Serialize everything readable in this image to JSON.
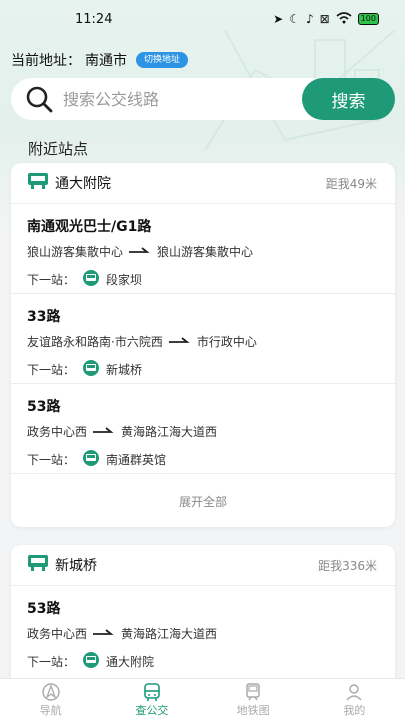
{
  "status_bar": {
    "time": "11:24",
    "battery": "100"
  },
  "address": {
    "label": "当前地址：",
    "city": "南通市",
    "switch_label": "切换地址"
  },
  "search": {
    "placeholder": "搜索公交线路",
    "button_label": "搜索"
  },
  "section_title": "附近站点",
  "stations": [
    {
      "name": "通大附院",
      "distance": "距我49米",
      "routes": [
        {
          "name": "南通观光巴士/G1路",
          "from": "狼山游客集散中心",
          "to": "狼山游客集散中心",
          "next_label": "下一站：",
          "next_stop": "段家坝"
        },
        {
          "name": "33路",
          "from": "友谊路永和路南·市六院西",
          "to": "市行政中心",
          "next_label": "下一站：",
          "next_stop": "新城桥"
        },
        {
          "name": "53路",
          "from": "政务中心西",
          "to": "黄海路江海大道西",
          "next_label": "下一站：",
          "next_stop": "南通群英馆"
        }
      ],
      "expand_label": "展开全部"
    },
    {
      "name": "新城桥",
      "distance": "距我336米",
      "routes": [
        {
          "name": "53路",
          "from": "政务中心西",
          "to": "黄海路江海大道西",
          "next_label": "下一站：",
          "next_stop": "通大附院"
        }
      ]
    }
  ],
  "tabs": [
    {
      "label": "导航",
      "icon": "navigation-icon",
      "active": false
    },
    {
      "label": "查公交",
      "icon": "bus-icon",
      "active": true
    },
    {
      "label": "地铁图",
      "icon": "metro-icon",
      "active": false
    },
    {
      "label": "我的",
      "icon": "user-icon",
      "active": false
    }
  ],
  "colors": {
    "accent": "#1e9a78",
    "switch_blue": "#2d93e4"
  }
}
